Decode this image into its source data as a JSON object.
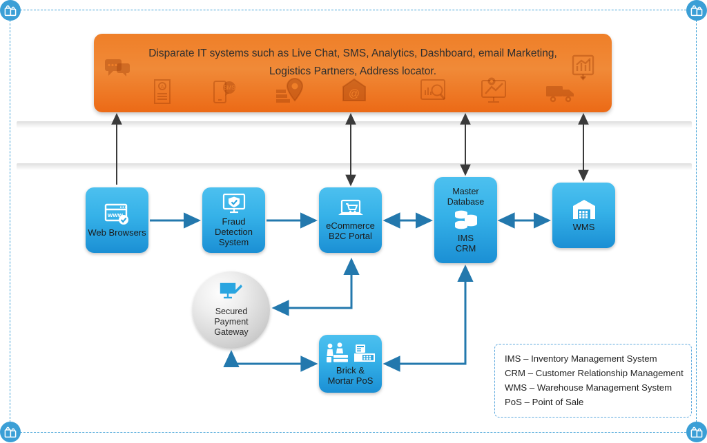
{
  "banner": {
    "text": "Disparate IT systems such as Live Chat, SMS, Analytics, Dashboard, email Marketing, Logistics Partners, Address locator.",
    "color": "#ef7f28",
    "icons": [
      "chat-bubbles-icon",
      "document-report-icon",
      "mobile-sms-icon",
      "map-location-pin-icon",
      "email-envelope-icon",
      "analytics-search-icon",
      "dashboard-gear-monitor-icon",
      "delivery-truck-icon",
      "bar-chart-growth-icon"
    ]
  },
  "nodes": {
    "web_browsers": {
      "label": "Web Browsers",
      "icon": "browser-www-check-icon"
    },
    "fraud": {
      "label": "Fraud\nDetection\nSystem",
      "icon": "monitor-shield-icon"
    },
    "ecommerce": {
      "label": "eCommerce\nB2C Portal",
      "icon": "laptop-cart-icon"
    },
    "master_db": {
      "title": "Master\nDatabase",
      "label": "IMS\nCRM",
      "icon": "database-stack-icon"
    },
    "wms": {
      "label": "WMS",
      "icon": "warehouse-icon"
    },
    "pos": {
      "label": "Brick &\nMortar PoS",
      "icon_left": "shop-counter-people-icon",
      "icon_right": "cash-register-icon"
    },
    "gateway": {
      "label": "Secured\nPayment\nGateway",
      "icon": "monitor-pen-signature-icon"
    }
  },
  "legend": {
    "lines": [
      "IMS – Inventory Management System",
      "CRM – Customer Relationship Management",
      "WMS – Warehouse Management System",
      "PoS – Point of Sale"
    ]
  },
  "corner_badge": {
    "icon": "shopping-bags-icon",
    "color": "#3b9fd6"
  },
  "colors": {
    "node_blue_light": "#4cc0ef",
    "node_blue_dark": "#1b8fd4",
    "banner_orange": "#ef7f28",
    "connector_blue": "#2378ad",
    "connector_dark": "#3a3a3a",
    "frame_dashed": "#3b9fd6"
  }
}
